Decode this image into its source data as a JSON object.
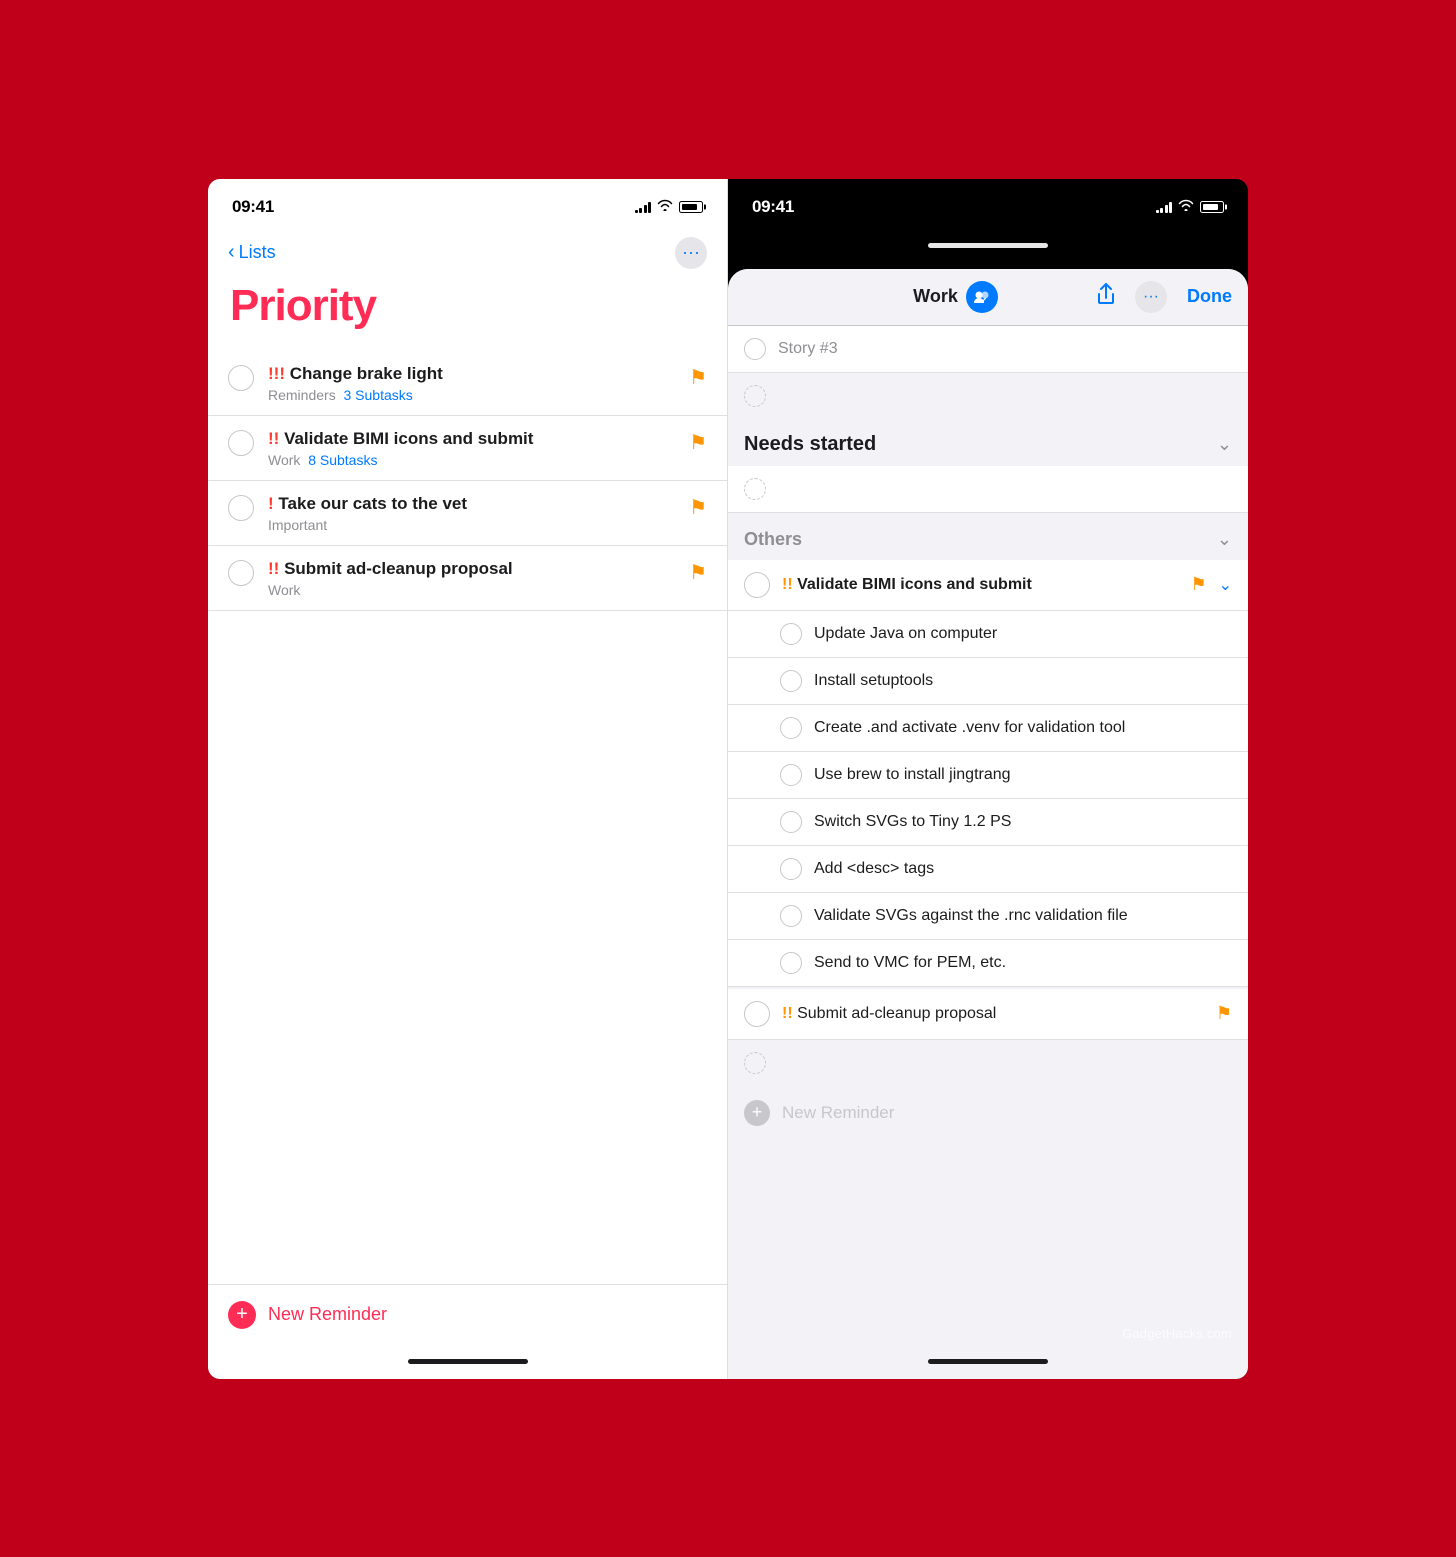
{
  "left_phone": {
    "status_time": "09:41",
    "nav": {
      "back_label": "Lists",
      "more_icon": "···"
    },
    "title": "Priority",
    "tasks": [
      {
        "priority_markers": "!!!",
        "title": "Change brake light",
        "subtitle_list": "Reminders",
        "subtitle_subtasks": "3 Subtasks",
        "has_flag": true
      },
      {
        "priority_markers": "!!",
        "title": "Validate BIMI icons and submit",
        "subtitle_list": "Work",
        "subtitle_subtasks": "8 Subtasks",
        "has_flag": true
      },
      {
        "priority_markers": "!",
        "title": "Take our cats to the vet",
        "subtitle_list": "Important",
        "subtitle_subtasks": null,
        "has_flag": true
      },
      {
        "priority_markers": "!!",
        "title": "Submit ad-cleanup proposal",
        "subtitle_list": "Work",
        "subtitle_subtasks": null,
        "has_flag": true
      }
    ],
    "new_reminder": "New Reminder"
  },
  "right_phone": {
    "status_time": "09:41",
    "nav": {
      "title": "Work",
      "share_icon": "↑",
      "more_icon": "···",
      "done_label": "Done"
    },
    "story_item": "Story #3",
    "sections": [
      {
        "id": "needs_started",
        "title": "Needs started",
        "collapsed": false,
        "tasks": []
      },
      {
        "id": "others",
        "title": "Others",
        "collapsed": false,
        "tasks": [
          {
            "priority_markers": "!!",
            "title": "Validate BIMI icons and submit",
            "has_flag": true,
            "has_chevron": true,
            "subtasks": [
              "Update Java on computer",
              "Install setuptools",
              "Create .and activate .venv for validation tool",
              "Use brew to install jingtrang",
              "Switch SVGs to Tiny 1.2 PS",
              "Add <desc> tags",
              "Validate SVGs against the .rnc validation file",
              "Send to VMC for PEM, etc."
            ]
          },
          {
            "priority_markers": "!!",
            "title": "Submit ad-cleanup proposal",
            "has_flag": true,
            "has_chevron": false,
            "subtasks": []
          }
        ]
      }
    ],
    "new_reminder": "New Reminder",
    "watermark": "GadgetHacks.com"
  }
}
